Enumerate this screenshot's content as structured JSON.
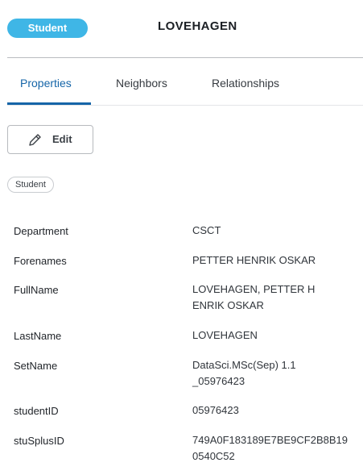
{
  "header": {
    "type_label": "Student",
    "title": "LOVEHAGEN"
  },
  "tabs": [
    {
      "label": "Properties",
      "active": true
    },
    {
      "label": "Neighbors",
      "active": false
    },
    {
      "label": "Relationships",
      "active": false
    }
  ],
  "toolbar": {
    "edit_label": "Edit",
    "edit_icon": "pencil-icon"
  },
  "labels": [
    "Student"
  ],
  "properties": [
    {
      "key": "Department",
      "value": "CSCT"
    },
    {
      "key": "Forenames",
      "value": "PETTER HENRIK OSKAR"
    },
    {
      "key": "FullName",
      "value": "LOVEHAGEN, PETTER HENRIK OSKAR"
    },
    {
      "key": "LastName",
      "value": "LOVEHAGEN"
    },
    {
      "key": "SetName",
      "value": "DataSci.MSc(Sep) 1.1_05976423"
    },
    {
      "key": "studentID",
      "value": "05976423"
    },
    {
      "key": "stuSplusID",
      "value": "749A0F183189E7BE9CF2B8B190540C52"
    }
  ],
  "colors": {
    "accent": "#1565a8",
    "type_pill": "#3fb6e6"
  }
}
